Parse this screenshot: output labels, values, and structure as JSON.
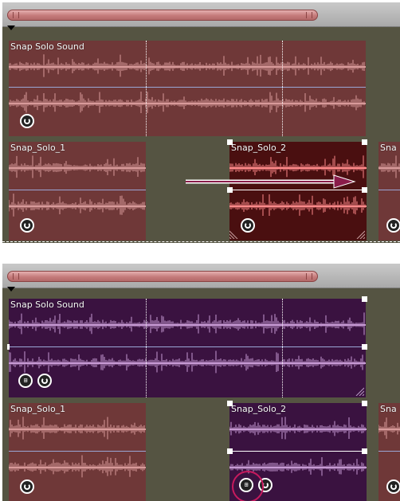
{
  "top_panel": {
    "clips": {
      "sound": {
        "title": "Snap Solo Sound"
      },
      "solo1": {
        "title": "Snap_Solo_1"
      },
      "solo2": {
        "title": "Snap_Solo_2"
      },
      "partial": {
        "title": "Sna"
      }
    }
  },
  "bottom_panel": {
    "clips": {
      "sound": {
        "title": "Snap Solo Sound"
      },
      "solo1": {
        "title": "Snap_Solo_1"
      },
      "solo2": {
        "title": "Snap_Solo_2"
      },
      "partial": {
        "title": "Sna"
      }
    }
  },
  "colors": {
    "clip_maroon": "#6f3838",
    "clip_selected_dark": "#4a0f10",
    "clip_grouped_purple": "#3a1240",
    "arrow": "#8a1c4a",
    "highlight": "#c81a5e",
    "timeline_bg": "#555442"
  },
  "icons": [
    "audio-icon",
    "group-link-icon",
    "move-arrow-icon",
    "scrollbar",
    "time-marker"
  ]
}
